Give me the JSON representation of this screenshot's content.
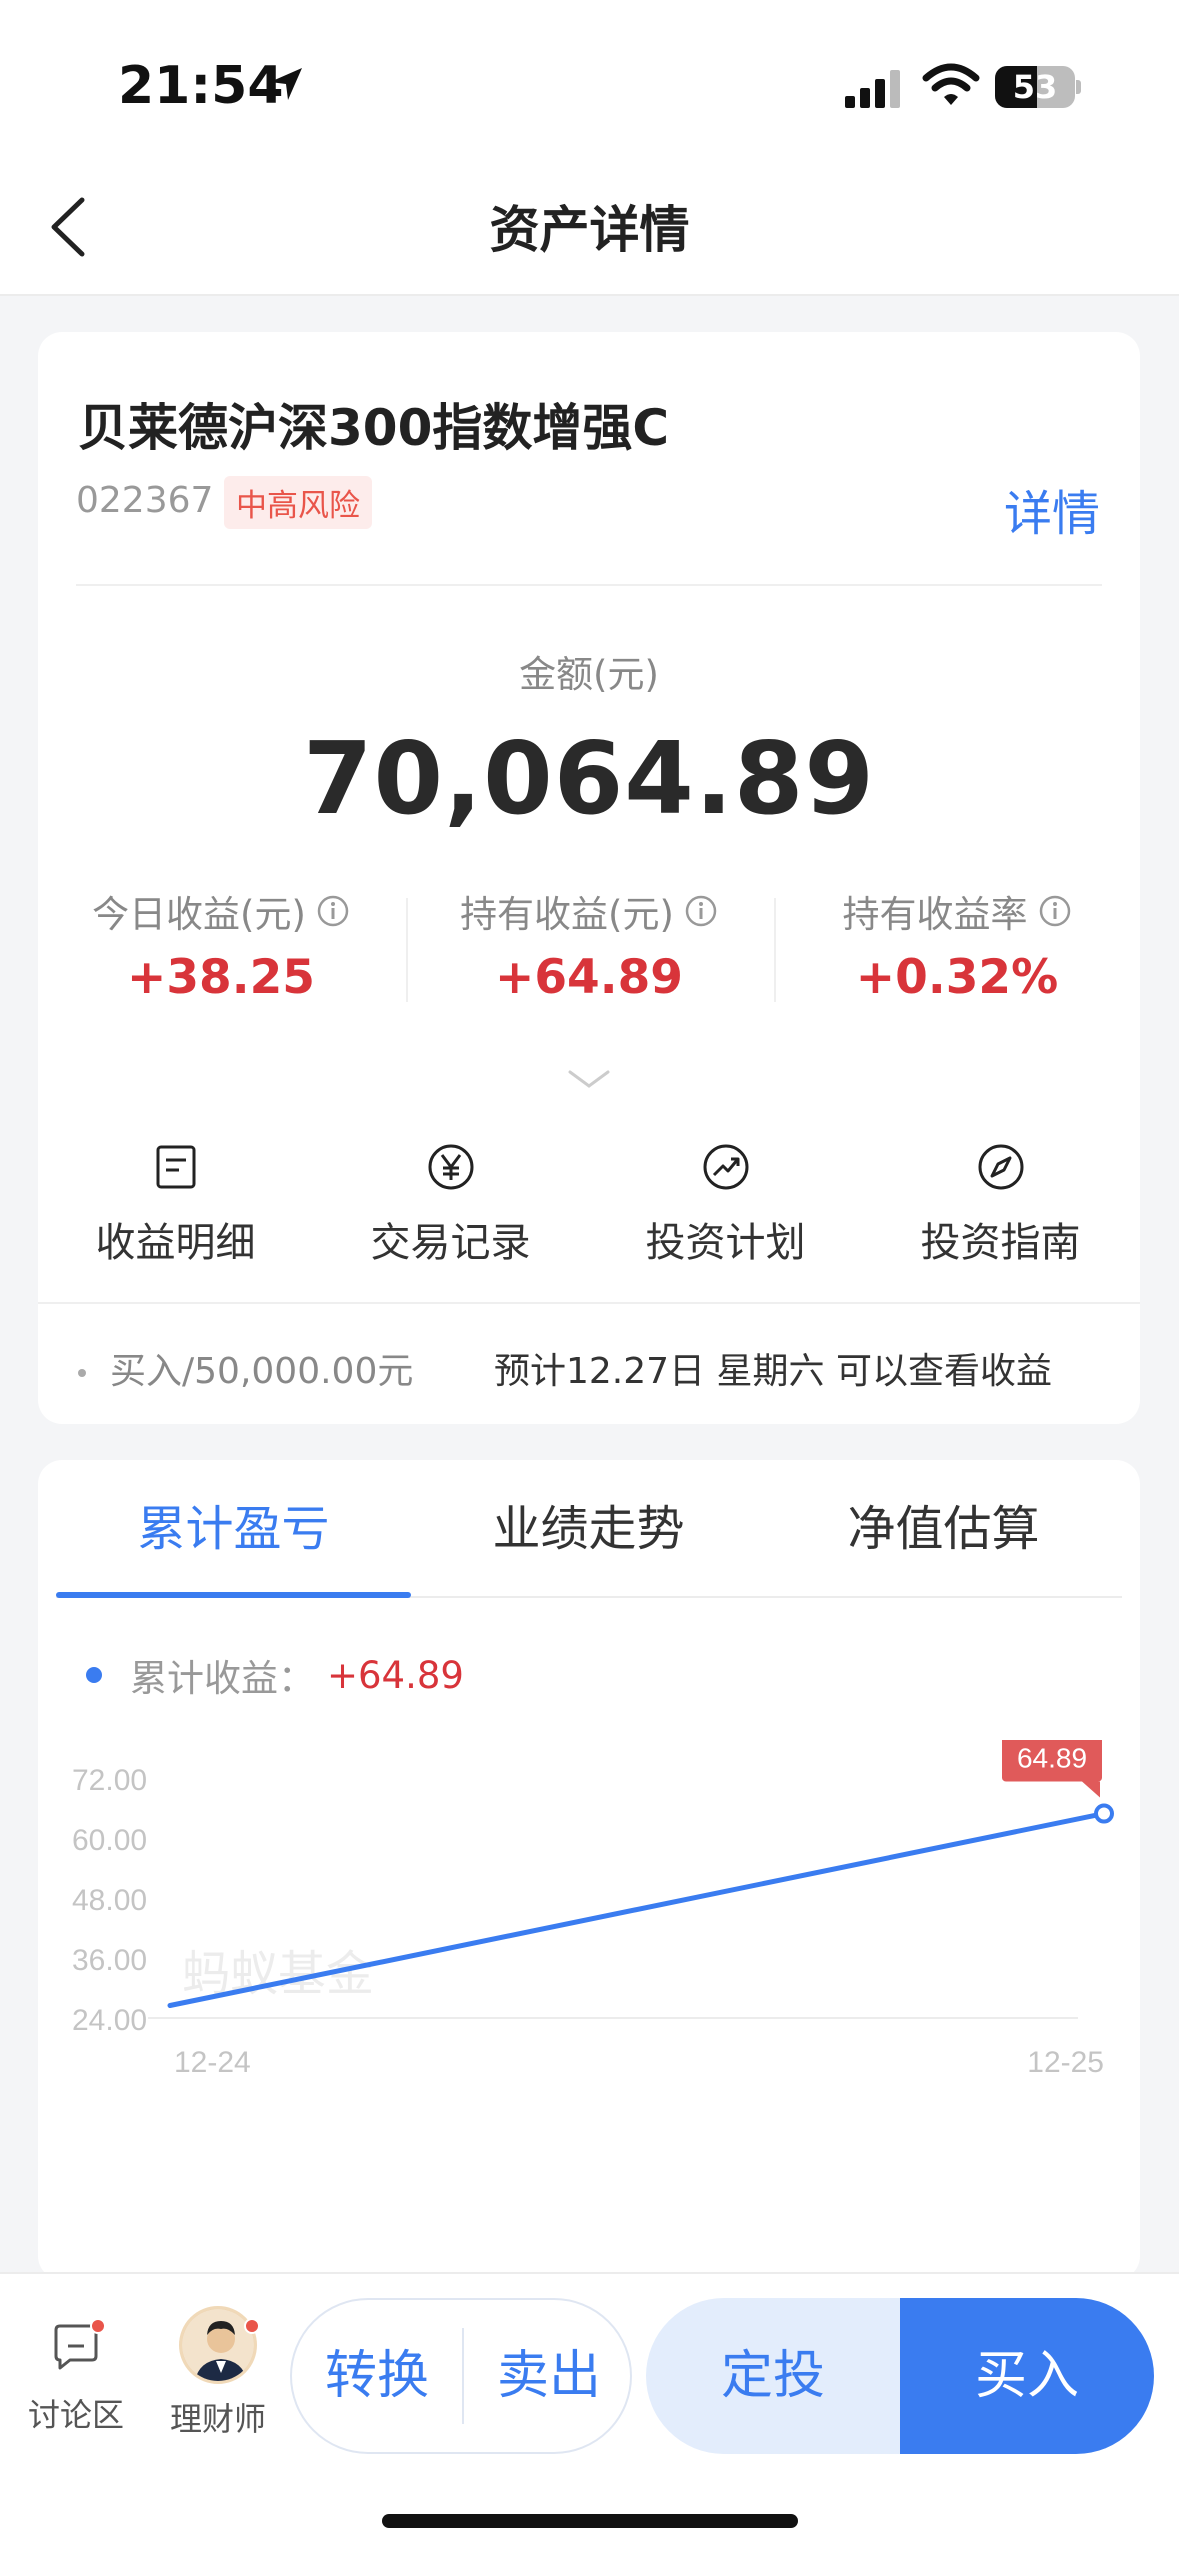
{
  "status_bar": {
    "time": "21:54",
    "battery": "53",
    "battery_level": 0.53
  },
  "nav": {
    "title": "资产详情"
  },
  "fund": {
    "name": "贝莱德沪深300指数增强C",
    "code": "022367",
    "risk": "中高风险",
    "detail_link": "详情",
    "amount_label": "金额(元)",
    "amount_value": "70,064.89",
    "stats": [
      {
        "label": "今日收益(元)",
        "value": "+38.25"
      },
      {
        "label": "持有收益(元)",
        "value": "+64.89"
      },
      {
        "label": "持有收益率",
        "value": "+0.32%"
      }
    ],
    "actions": [
      {
        "label": "收益明细",
        "icon": "document-icon"
      },
      {
        "label": "交易记录",
        "icon": "yen-icon"
      },
      {
        "label": "投资计划",
        "icon": "trend-icon"
      },
      {
        "label": "投资指南",
        "icon": "compass-icon"
      }
    ],
    "buy_note": "买入/50,000.00元",
    "buy_estimate": "预计12.27日 星期六 可以查看收益"
  },
  "chart_tabs": [
    "累计盈亏",
    "业绩走势",
    "净值估算"
  ],
  "chart_legend": {
    "label": "累计收益：",
    "value": "+64.89"
  },
  "chart_data": {
    "type": "line",
    "x": [
      "12-24",
      "12-25"
    ],
    "series": [
      {
        "name": "累计收益",
        "values": [
          26.5,
          64.89
        ]
      }
    ],
    "y_ticks": [
      "72.00",
      "60.00",
      "48.00",
      "36.00",
      "24.00"
    ],
    "x_tick_labels": [
      "12-24",
      "12-25"
    ],
    "ylim": [
      24,
      72
    ],
    "last_point_label": "64.89",
    "watermark": "蚂蚁基金",
    "line_color": "#3a7cf0",
    "tooltip_color": "#e05a5a"
  },
  "bottom_bar": {
    "forum_label": "讨论区",
    "advisor_label": "理财师",
    "convert_label": "转换",
    "sell_label": "卖出",
    "auto_invest_label": "定投",
    "buy_label": "买入"
  }
}
